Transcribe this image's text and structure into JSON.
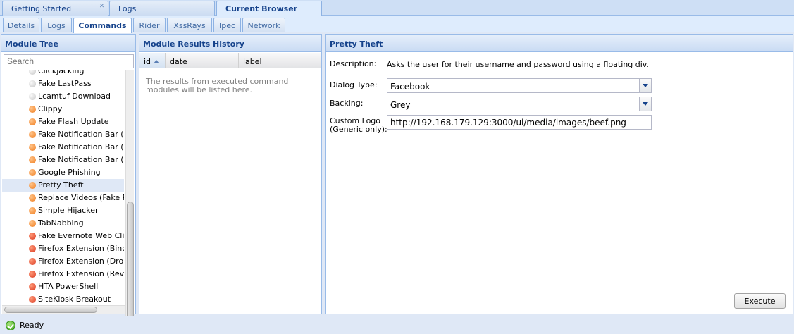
{
  "top_tabs": [
    {
      "label": "Getting Started",
      "closable": true
    },
    {
      "label": "Logs",
      "closable": false
    },
    {
      "label": "Current Browser",
      "closable": false,
      "active": true
    }
  ],
  "sub_tabs": [
    {
      "label": "Details"
    },
    {
      "label": "Logs"
    },
    {
      "label": "Commands",
      "active": true
    },
    {
      "label": "Rider"
    },
    {
      "label": "XssRays"
    },
    {
      "label": "Ipec"
    },
    {
      "label": "Network"
    }
  ],
  "module_tree": {
    "title": "Module Tree",
    "search_placeholder": "Search",
    "items": [
      {
        "label": "Clickjacking",
        "status": "grey"
      },
      {
        "label": "Fake LastPass",
        "status": "grey"
      },
      {
        "label": "Lcamtuf Download",
        "status": "grey"
      },
      {
        "label": "Clippy",
        "status": "orange"
      },
      {
        "label": "Fake Flash Update",
        "status": "orange"
      },
      {
        "label": "Fake Notification Bar (Chr",
        "status": "orange"
      },
      {
        "label": "Fake Notification Bar (Fire",
        "status": "orange"
      },
      {
        "label": "Fake Notification Bar (IE)",
        "status": "orange"
      },
      {
        "label": "Google Phishing",
        "status": "orange"
      },
      {
        "label": "Pretty Theft",
        "status": "orange",
        "selected": true
      },
      {
        "label": "Replace Videos (Fake Plu",
        "status": "orange"
      },
      {
        "label": "Simple Hijacker",
        "status": "orange"
      },
      {
        "label": "TabNabbing",
        "status": "orange"
      },
      {
        "label": "Fake Evernote Web Clippe",
        "status": "red"
      },
      {
        "label": "Firefox Extension (Bindsh",
        "status": "red"
      },
      {
        "label": "Firefox Extension (Droppe",
        "status": "red"
      },
      {
        "label": "Firefox Extension (Revers",
        "status": "red"
      },
      {
        "label": "HTA PowerShell",
        "status": "red"
      },
      {
        "label": "SiteKiosk Breakout",
        "status": "red"
      }
    ]
  },
  "results": {
    "title": "Module Results History",
    "columns": [
      "id",
      "date",
      "label"
    ],
    "sorted_column": "id",
    "empty_text": "The results from executed command modules will be listed here."
  },
  "module": {
    "title": "Pretty Theft",
    "description_label": "Description:",
    "description": "Asks the user for their username and password using a floating div.",
    "dialog_type_label": "Dialog Type:",
    "dialog_type_value": "Facebook",
    "backing_label": "Backing:",
    "backing_value": "Grey",
    "custom_logo_label_1": "Custom Logo",
    "custom_logo_label_2": "(Generic only):",
    "custom_logo_value": "http://192.168.179.129:3000/ui/media/images/beef.png",
    "execute_label": "Execute"
  },
  "status_bar": {
    "text": "Ready"
  }
}
